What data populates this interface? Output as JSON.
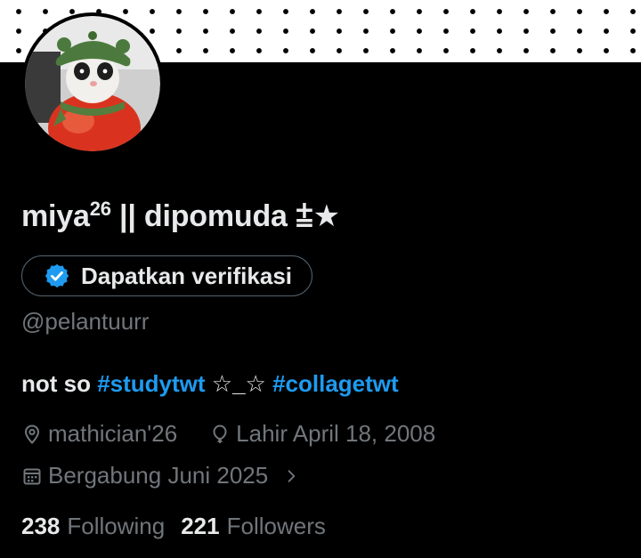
{
  "profile": {
    "display_name": "miya",
    "display_name_sup": "26",
    "display_name_rest": " || dipomuda ",
    "display_name_symbol": "⩲★",
    "handle": "@pelantuurr",
    "verify_button": {
      "label": "Dapatkan verifikasi",
      "badge_color": "#1d9bf0"
    },
    "bio": {
      "part1": "not so ",
      "tag1": "#studytwt",
      "part2": " ☆_☆ ",
      "tag2": "#collagetwt"
    },
    "location": "mathician'26",
    "birthday": "Lahir April 18, 2008",
    "joined": "Bergabung Juni 2025",
    "following_count": "238",
    "following_label": "Following",
    "followers_count": "221",
    "followers_label": "Followers"
  },
  "icons": {
    "location": "location-pin-icon",
    "birthday": "balloon-icon",
    "joined": "calendar-icon",
    "chevron": "chevron-right-icon",
    "verify": "verified-badge-icon"
  },
  "colors": {
    "background": "#000000",
    "text_primary": "#e7e9ea",
    "text_secondary": "#71767b",
    "accent": "#1d9bf0"
  }
}
